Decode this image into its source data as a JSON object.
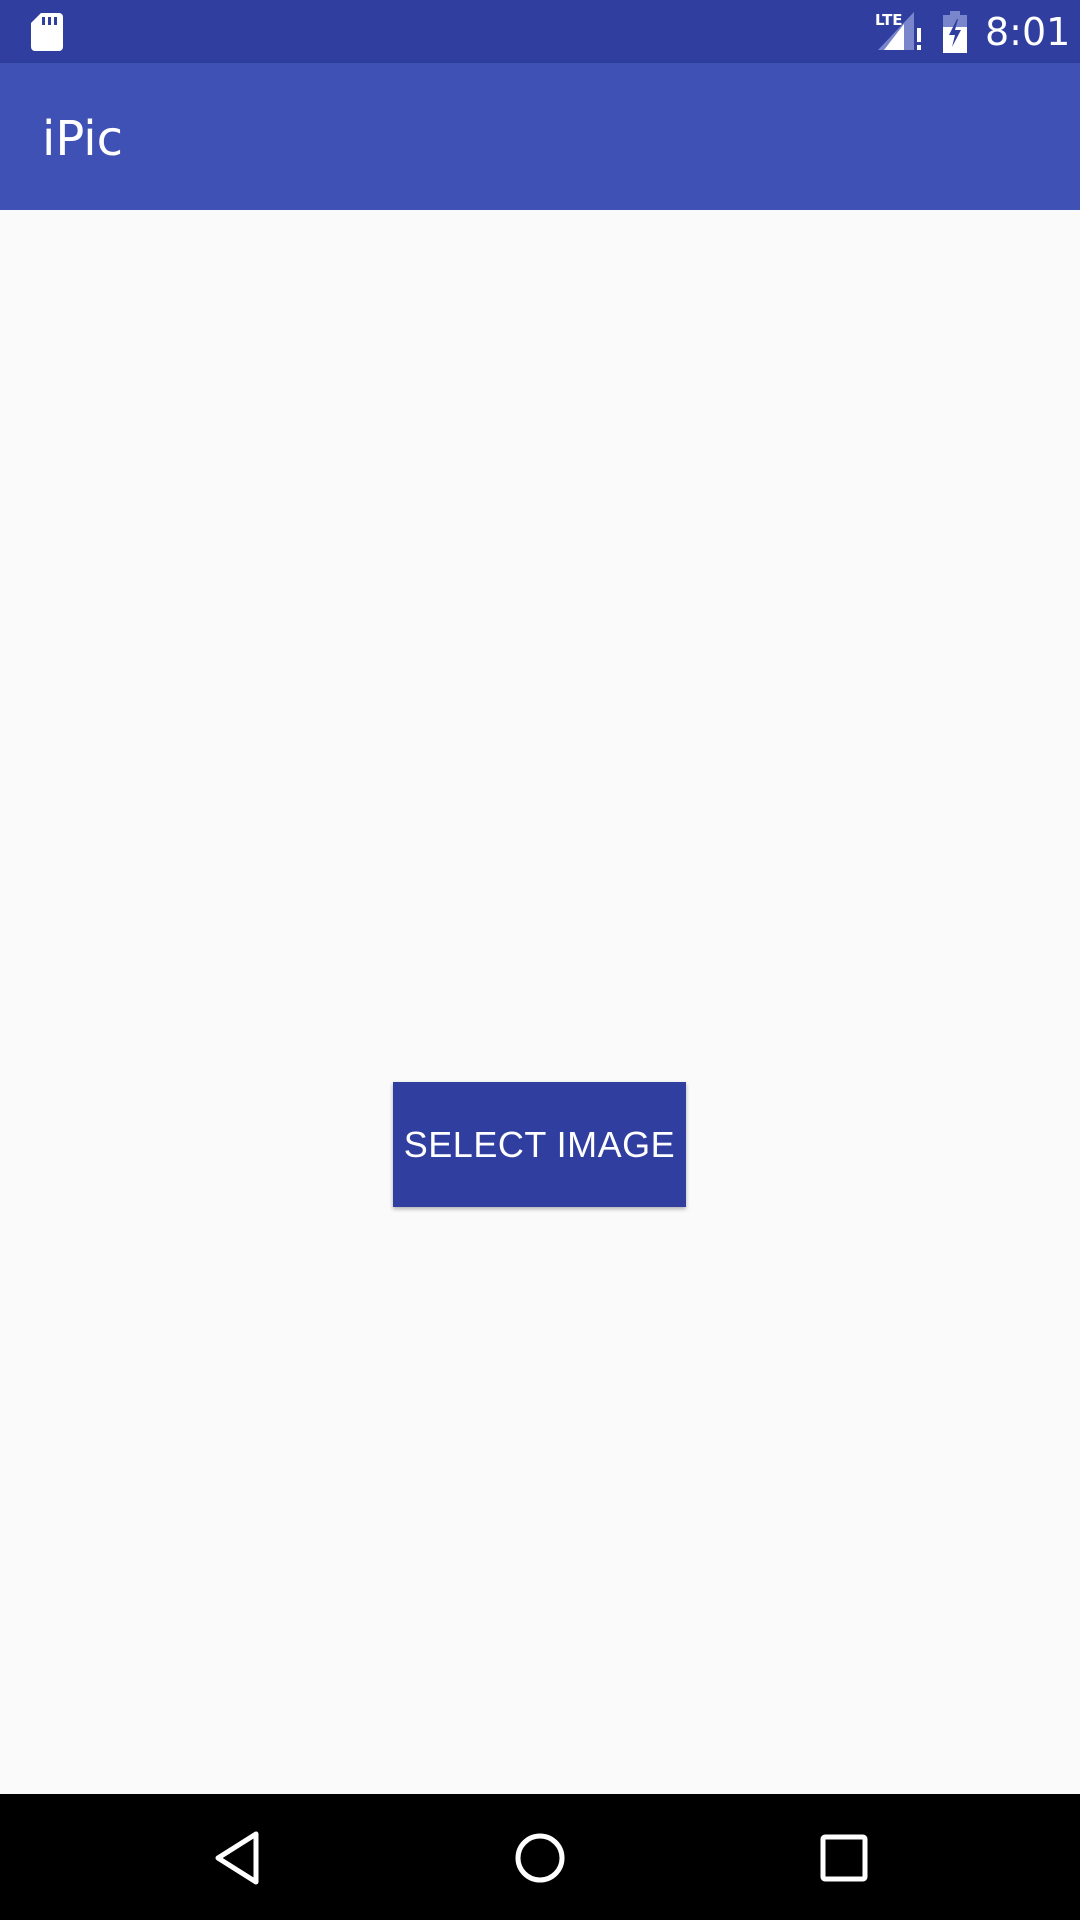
{
  "status_bar": {
    "time": "8:01",
    "network_label": "LTE",
    "icons": [
      "sd-card-icon",
      "lte-signal-icon",
      "battery-charging-icon"
    ],
    "background": "#303f9f"
  },
  "app_bar": {
    "title": "iPic",
    "background": "#3f51b5"
  },
  "main": {
    "select_button_label": "SELECT IMAGE",
    "button_color": "#303f9f",
    "background": "#fafafa"
  },
  "nav_bar": {
    "icons": [
      "back-icon",
      "home-icon",
      "recents-icon"
    ],
    "background": "#000000"
  }
}
